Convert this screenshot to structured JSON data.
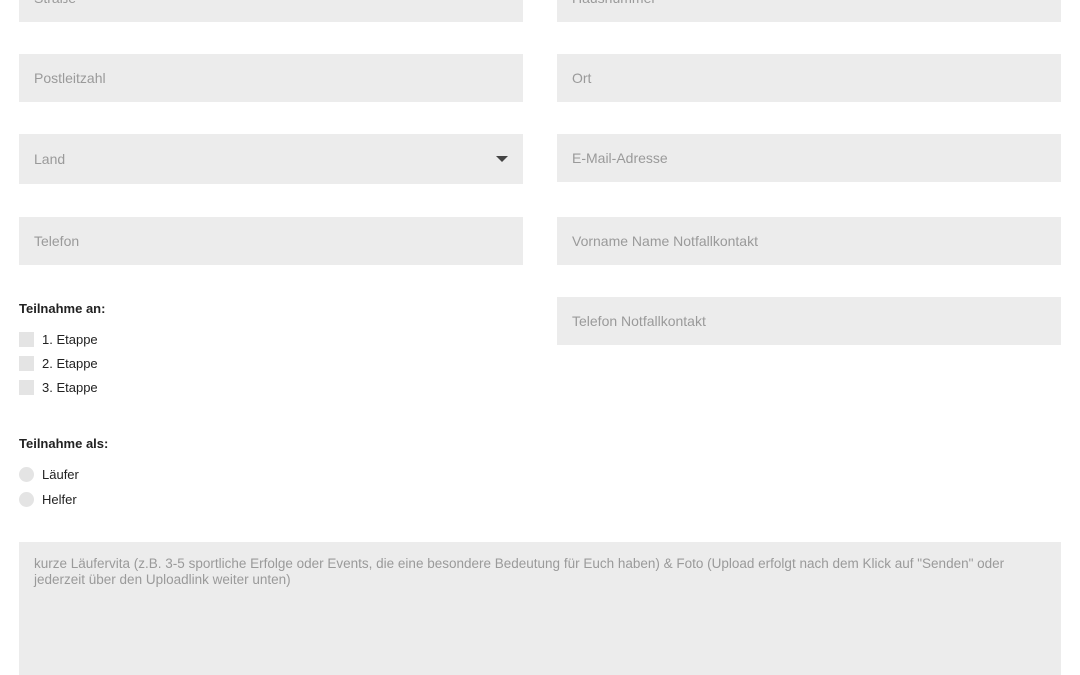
{
  "address": {
    "street_placeholder": "Straße",
    "house_number_placeholder": "Hausnummer",
    "postal_code_placeholder": "Postleitzahl",
    "city_placeholder": "Ort",
    "country_label": "Land",
    "email_placeholder": "E-Mail-Adresse",
    "phone_placeholder": "Telefon",
    "emergency_name_placeholder": "Vorname Name Notfallkontakt",
    "emergency_phone_placeholder": "Telefon Notfallkontakt"
  },
  "participation": {
    "title": "Teilnahme an:",
    "options": [
      "1. Etappe",
      "2. Etappe",
      "3. Etappe"
    ]
  },
  "role": {
    "title": "Teilnahme als:",
    "options": [
      "Läufer",
      "Helfer"
    ]
  },
  "bio": {
    "placeholder": "kurze Läufervita (z.B. 3-5 sportliche Erfolge oder Events, die eine besondere Bedeutung für Euch haben) & Foto (Upload erfolgt nach dem Klick auf \"Senden\" oder jederzeit über den Uploadlink weiter unten)"
  },
  "colors": {
    "field_background": "#ececec",
    "placeholder_text": "#9a9a9a",
    "label_text": "#222222"
  }
}
